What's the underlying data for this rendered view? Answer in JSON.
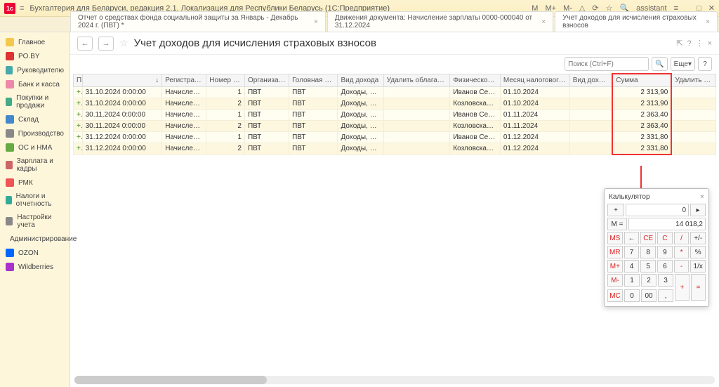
{
  "app": {
    "title": "Бухгалтерия для Беларуси, редакция 2.1. Локализация для Республики Беларусь  (1С:Предприятие)",
    "top_buttons": {
      "m": "M",
      "mp": "M+",
      "mm": "M-",
      "bell": "△",
      "clock": "⟳",
      "star": "☆",
      "search": "🔍",
      "user": "assistant",
      "lines": "≡",
      "min": "_",
      "max": "□",
      "close": "✕"
    }
  },
  "tabs": [
    {
      "label": "Отчет о средствах фонда социальной защиты за Январь - Декабрь 2024 г. (ПВТ) *",
      "close": "×"
    },
    {
      "label": "Движения документа: Начисление зарплаты 0000-000040 от 31.12.2024",
      "close": "×"
    },
    {
      "label": "Учет доходов для исчисления страховых взносов",
      "close": "×",
      "active": true
    }
  ],
  "sidebar": [
    {
      "label": "Главное",
      "color": "#f2c94c"
    },
    {
      "label": "PO.BY",
      "color": "#d33"
    },
    {
      "label": "Руководителю",
      "color": "#4aa"
    },
    {
      "label": "Банк и касса",
      "color": "#e8a"
    },
    {
      "label": "Покупки и продажи",
      "color": "#4a8"
    },
    {
      "label": "Склад",
      "color": "#48c"
    },
    {
      "label": "Производство",
      "color": "#888"
    },
    {
      "label": "ОС и НМА",
      "color": "#6a4"
    },
    {
      "label": "Зарплата и кадры",
      "color": "#c66"
    },
    {
      "label": "РМК",
      "color": "#e55"
    },
    {
      "label": "Налоги и отчетность",
      "color": "#3a9"
    },
    {
      "label": "Настройки учета",
      "color": "#888"
    },
    {
      "label": "Администрирование",
      "color": "#888"
    },
    {
      "label": "OZON",
      "color": "#06f"
    },
    {
      "label": "Wildberries",
      "color": "#a3c"
    }
  ],
  "page": {
    "nav_back": "←",
    "nav_fwd": "→",
    "star": "☆",
    "title": "Учет доходов для исчисления страховых взносов",
    "link_icon": "⇱",
    "help": "?",
    "more": "⋮",
    "close": "×",
    "search_placeholder": "Поиск (Ctrl+F)",
    "search_btn": "🔍",
    "more_btn": "Еще",
    "help_btn": "?"
  },
  "columns": [
    "Период",
    "",
    "Регистратор",
    "Номер строки",
    "Организация",
    "Головная орган…",
    "Вид дохода",
    "Удалить облагается ЕНВД",
    "Физическое лицо",
    "Месяц налогового периода",
    "Вид дохода уд…",
    "Сумма",
    "Удалить скидка"
  ],
  "sort_indicator": "↓",
  "rows": [
    {
      "period": "31.10.2024 0:00:00",
      "reg": "Начисление за…",
      "line": "1",
      "org": "ПВТ",
      "head": "ПВТ",
      "kind": "Доходы, целик…",
      "envd": "",
      "person": "Иванов Сергей …",
      "month": "01.10.2024",
      "kind2": "",
      "sum": "2 313,90",
      "disc": ""
    },
    {
      "period": "31.10.2024 0:00:00",
      "reg": "Начисление за…",
      "line": "2",
      "org": "ПВТ",
      "head": "ПВТ",
      "kind": "Доходы, целик…",
      "envd": "",
      "person": "Козловская Ел…",
      "month": "01.10.2024",
      "kind2": "",
      "sum": "2 313,90",
      "disc": ""
    },
    {
      "period": "30.11.2024 0:00:00",
      "reg": "Начисление за…",
      "line": "1",
      "org": "ПВТ",
      "head": "ПВТ",
      "kind": "Доходы, целик…",
      "envd": "",
      "person": "Иванов Сергей …",
      "month": "01.11.2024",
      "kind2": "",
      "sum": "2 363,40",
      "disc": ""
    },
    {
      "period": "30.11.2024 0:00:00",
      "reg": "Начисление за…",
      "line": "2",
      "org": "ПВТ",
      "head": "ПВТ",
      "kind": "Доходы, целик…",
      "envd": "",
      "person": "Козловская Ел…",
      "month": "01.11.2024",
      "kind2": "",
      "sum": "2 363,40",
      "disc": ""
    },
    {
      "period": "31.12.2024 0:00:00",
      "reg": "Начисление за…",
      "line": "1",
      "org": "ПВТ",
      "head": "ПВТ",
      "kind": "Доходы, целик…",
      "envd": "",
      "person": "Иванов Сергей …",
      "month": "01.12.2024",
      "kind2": "",
      "sum": "2 331,80",
      "disc": ""
    },
    {
      "period": "31.12.2024 0:00:00",
      "reg": "Начисление за…",
      "line": "2",
      "org": "ПВТ",
      "head": "ПВТ",
      "kind": "Доходы, целик…",
      "envd": "",
      "person": "Козловская Ел…",
      "month": "01.12.2024",
      "kind2": "",
      "sum": "2 331,80",
      "disc": ""
    }
  ],
  "calc": {
    "title": "Калькулятор",
    "close": "×",
    "disp1_label": "+",
    "disp1": "0",
    "mem_icon": "▸",
    "mem_label": "M =",
    "mem_val": "14 018,2",
    "ms": "MS",
    "revsign": "←",
    "ce": "CE",
    "c": "C",
    "div": "/",
    "pm": "+/-",
    "mr": "MR",
    "b7": "7",
    "b8": "8",
    "b9": "9",
    "mul": "*",
    "pct": "%",
    "mp": "M+",
    "b4": "4",
    "b5": "5",
    "b6": "6",
    "minus": "-",
    "inv": "1/x",
    "mm": "M-",
    "b1": "1",
    "b2": "2",
    "b3": "3",
    "plus": "+",
    "eq": "=",
    "mc": "MC",
    "b0": "0",
    "b00": "00",
    "dot": ","
  }
}
